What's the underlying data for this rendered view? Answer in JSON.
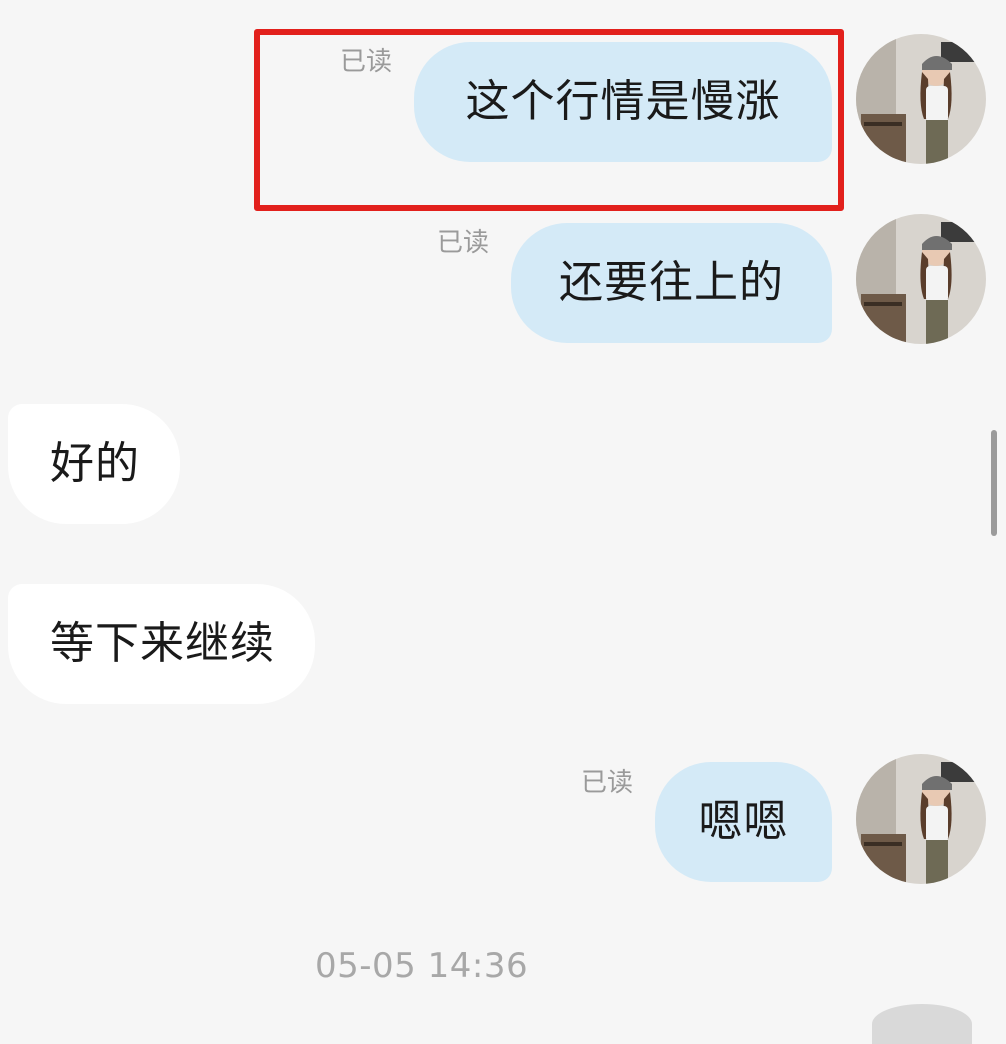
{
  "messages": [
    {
      "direction": "out",
      "text": "这个行情是慢涨",
      "status": "已读"
    },
    {
      "direction": "out",
      "text": "还要往上的",
      "status": "已读"
    },
    {
      "direction": "in",
      "text": "好的"
    },
    {
      "direction": "in",
      "text": "等下来继续"
    },
    {
      "direction": "out",
      "text": "嗯嗯",
      "status": "已读"
    }
  ],
  "timestamp": "05-05 14:36",
  "avatar_icon": "user-avatar-photo",
  "colors": {
    "outgoing_bubble": "#d4eaf7",
    "incoming_bubble": "#ffffff",
    "background": "#f6f6f6",
    "highlight_border": "#e2201c"
  }
}
